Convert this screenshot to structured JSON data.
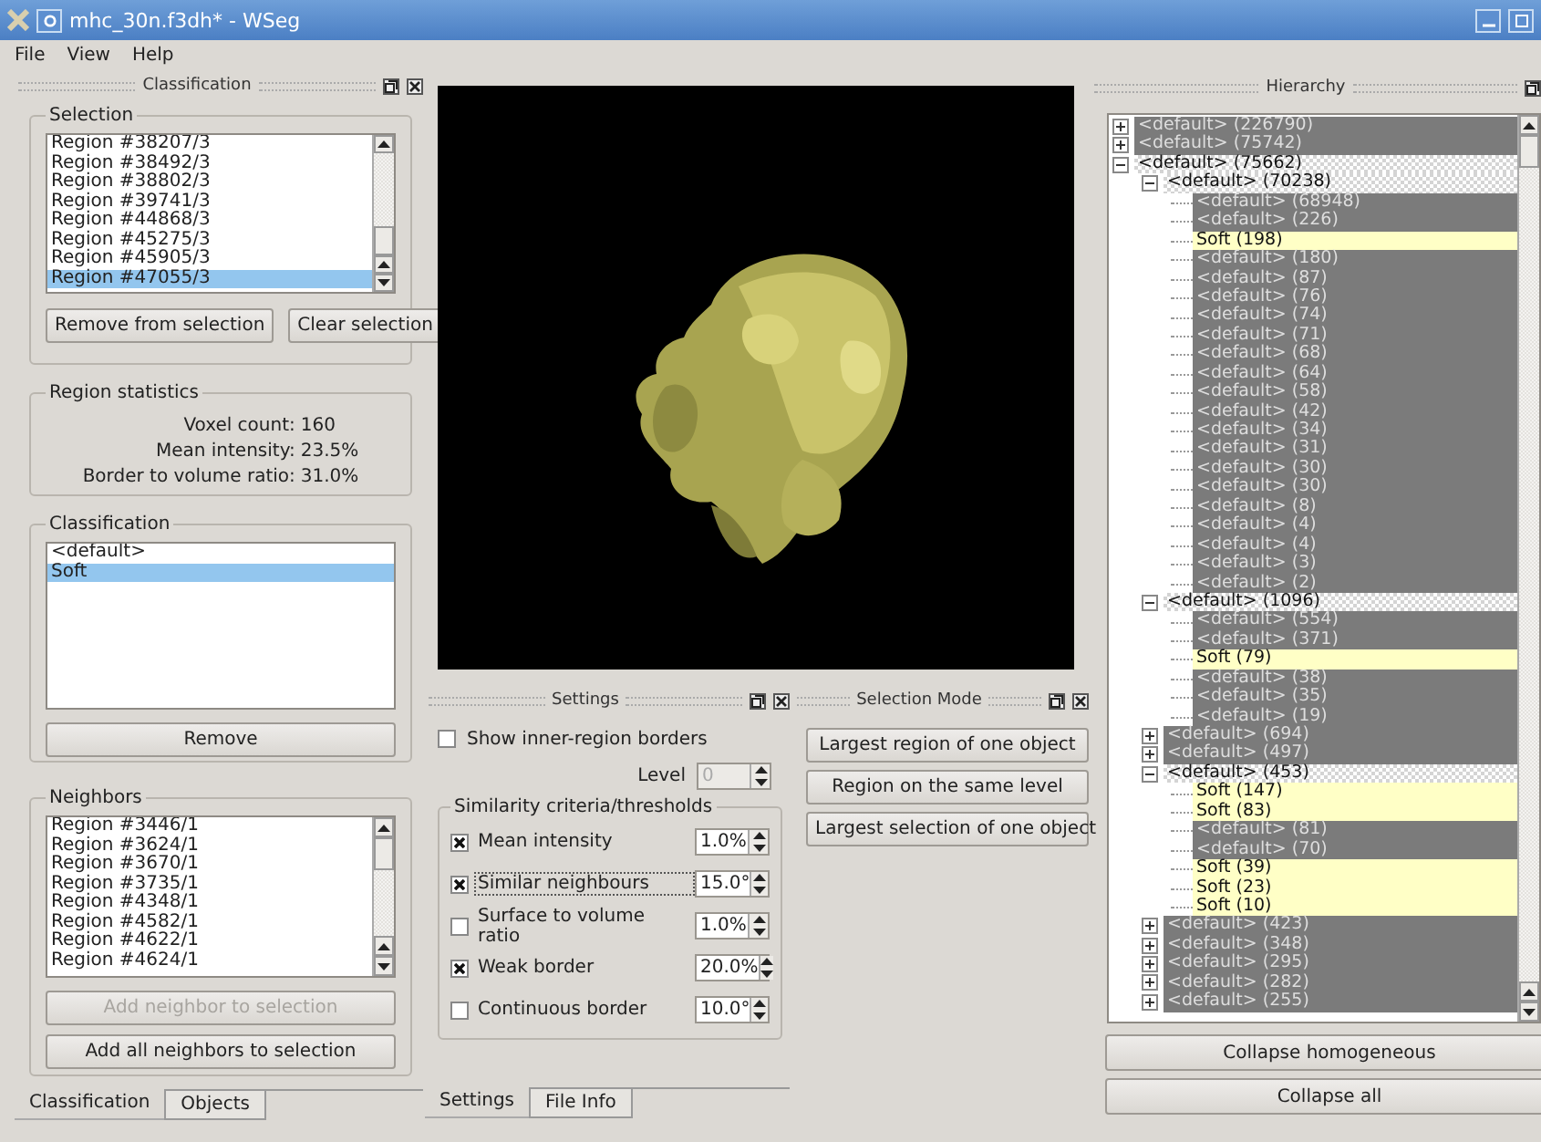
{
  "window": {
    "title": "mhc_30n.f3dh* - WSeg"
  },
  "menu": [
    "File",
    "View",
    "Help"
  ],
  "classification_dock": {
    "title": "Classification",
    "selection": {
      "title": "Selection",
      "items": [
        {
          "label": "Region #38207/3",
          "selected": false
        },
        {
          "label": "Region #38492/3",
          "selected": false
        },
        {
          "label": "Region #38802/3",
          "selected": false
        },
        {
          "label": "Region #39741/3",
          "selected": false
        },
        {
          "label": "Region #44868/3",
          "selected": false
        },
        {
          "label": "Region #45275/3",
          "selected": false
        },
        {
          "label": "Region #45905/3",
          "selected": false
        },
        {
          "label": "Region #47055/3",
          "selected": true
        }
      ],
      "buttons": [
        "Remove from selection",
        "Clear selection"
      ]
    },
    "region_statistics": {
      "title": "Region statistics",
      "rows": [
        {
          "label": "Voxel count:",
          "value": "160"
        },
        {
          "label": "Mean intensity:",
          "value": "23.5%"
        },
        {
          "label": "Border to volume ratio:",
          "value": "31.0%"
        }
      ]
    },
    "classification": {
      "title": "Classification",
      "items": [
        {
          "label": "<default>",
          "selected": false
        },
        {
          "label": "Soft",
          "selected": true
        }
      ],
      "button": "Remove"
    },
    "neighbors": {
      "title": "Neighbors",
      "items": [
        {
          "label": "Region #3446/1",
          "selected": false
        },
        {
          "label": "Region #3624/1",
          "selected": false
        },
        {
          "label": "Region #3670/1",
          "selected": false
        },
        {
          "label": "Region #3735/1",
          "selected": false
        },
        {
          "label": "Region #4348/1",
          "selected": false
        },
        {
          "label": "Region #4582/1",
          "selected": false
        },
        {
          "label": "Region #4622/1",
          "selected": false
        },
        {
          "label": "Region #4624/1",
          "selected": false
        }
      ],
      "buttons": [
        {
          "label": "Add neighbor to selection",
          "disabled": true
        },
        {
          "label": "Add all neighbors to selection",
          "disabled": false
        }
      ]
    }
  },
  "left_tabs": [
    {
      "label": "Classification",
      "selected": true
    },
    {
      "label": "Objects",
      "selected": false
    }
  ],
  "settings_dock": {
    "title": "Settings",
    "show_borders": {
      "label": "Show inner-region borders",
      "checked": false
    },
    "level": {
      "label": "Level",
      "value": "0",
      "disabled": true
    },
    "criteria": {
      "title": "Similarity criteria/thresholds",
      "items": [
        {
          "label": "Mean intensity",
          "checked": true,
          "focused": false,
          "value": "1.0%"
        },
        {
          "label": "Similar neighbours",
          "checked": true,
          "focused": true,
          "value": "15.0°"
        },
        {
          "label": "Surface to volume ratio",
          "checked": false,
          "focused": false,
          "value": "1.0%"
        },
        {
          "label": "Weak border",
          "checked": true,
          "focused": false,
          "value": "20.0%"
        },
        {
          "label": "Continuous border",
          "checked": false,
          "focused": false,
          "value": "10.0°"
        }
      ]
    }
  },
  "selection_mode_dock": {
    "title": "Selection Mode",
    "buttons": [
      "Largest region of one object",
      "Region on the same level",
      "Largest selection of one object"
    ]
  },
  "center_tabs": [
    {
      "label": "Settings",
      "selected": true
    },
    {
      "label": "File Info",
      "selected": false
    }
  ],
  "hierarchy_dock": {
    "title": "Hierarchy",
    "tree": [
      {
        "label": "<default> (226790)",
        "kind": "default",
        "expanded": false
      },
      {
        "label": "<default> (75742)",
        "kind": "default",
        "expanded": false
      },
      {
        "label": "<default> (75662)",
        "kind": "mixed",
        "expanded": true,
        "children": [
          {
            "label": "<default> (70238)",
            "kind": "mixed",
            "expanded": true,
            "children": [
              {
                "label": "<default> (68948)",
                "kind": "default"
              },
              {
                "label": "<default> (226)",
                "kind": "default"
              },
              {
                "label": "Soft (198)",
                "kind": "soft"
              },
              {
                "label": "<default> (180)",
                "kind": "default"
              },
              {
                "label": "<default> (87)",
                "kind": "default"
              },
              {
                "label": "<default> (76)",
                "kind": "default"
              },
              {
                "label": "<default> (74)",
                "kind": "default"
              },
              {
                "label": "<default> (71)",
                "kind": "default"
              },
              {
                "label": "<default> (68)",
                "kind": "default"
              },
              {
                "label": "<default> (64)",
                "kind": "default"
              },
              {
                "label": "<default> (58)",
                "kind": "default"
              },
              {
                "label": "<default> (42)",
                "kind": "default"
              },
              {
                "label": "<default> (34)",
                "kind": "default"
              },
              {
                "label": "<default> (31)",
                "kind": "default"
              },
              {
                "label": "<default> (30)",
                "kind": "default"
              },
              {
                "label": "<default> (30)",
                "kind": "default"
              },
              {
                "label": "<default> (8)",
                "kind": "default"
              },
              {
                "label": "<default> (4)",
                "kind": "default"
              },
              {
                "label": "<default> (4)",
                "kind": "default"
              },
              {
                "label": "<default> (3)",
                "kind": "default"
              },
              {
                "label": "<default> (2)",
                "kind": "default"
              }
            ]
          },
          {
            "label": "<default> (1096)",
            "kind": "mixed",
            "expanded": true,
            "children": [
              {
                "label": "<default> (554)",
                "kind": "default"
              },
              {
                "label": "<default> (371)",
                "kind": "default"
              },
              {
                "label": "Soft (79)",
                "kind": "soft"
              },
              {
                "label": "<default> (38)",
                "kind": "default"
              },
              {
                "label": "<default> (35)",
                "kind": "default"
              },
              {
                "label": "<default> (19)",
                "kind": "default"
              }
            ]
          },
          {
            "label": "<default> (694)",
            "kind": "default",
            "expanded": false
          },
          {
            "label": "<default> (497)",
            "kind": "default",
            "expanded": false
          },
          {
            "label": "<default> (453)",
            "kind": "mixed",
            "expanded": true,
            "children": [
              {
                "label": "Soft (147)",
                "kind": "soft"
              },
              {
                "label": "Soft (83)",
                "kind": "soft"
              },
              {
                "label": "<default> (81)",
                "kind": "default"
              },
              {
                "label": "<default> (70)",
                "kind": "default"
              },
              {
                "label": "Soft (39)",
                "kind": "soft"
              },
              {
                "label": "Soft (23)",
                "kind": "soft"
              },
              {
                "label": "Soft (10)",
                "kind": "soft"
              }
            ]
          },
          {
            "label": "<default> (423)",
            "kind": "default",
            "expanded": false
          },
          {
            "label": "<default> (348)",
            "kind": "default",
            "expanded": false
          },
          {
            "label": "<default> (295)",
            "kind": "default",
            "expanded": false
          },
          {
            "label": "<default> (282)",
            "kind": "default",
            "expanded": false
          },
          {
            "label": "<default> (255)",
            "kind": "default",
            "expanded": false
          }
        ]
      }
    ],
    "buttons": [
      "Collapse homogeneous",
      "Collapse all"
    ]
  }
}
